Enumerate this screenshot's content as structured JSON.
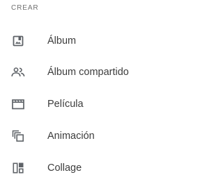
{
  "menu": {
    "header": "CREAR",
    "items": [
      {
        "label": "Álbum",
        "icon": "album-icon"
      },
      {
        "label": "Álbum compartido",
        "icon": "shared-album-icon"
      },
      {
        "label": "Película",
        "icon": "movie-icon"
      },
      {
        "label": "Animación",
        "icon": "animation-icon"
      },
      {
        "label": "Collage",
        "icon": "collage-icon"
      }
    ]
  },
  "colors": {
    "icon": "#5f6368",
    "text": "#3c3c3c",
    "header": "#6f6f6f"
  }
}
